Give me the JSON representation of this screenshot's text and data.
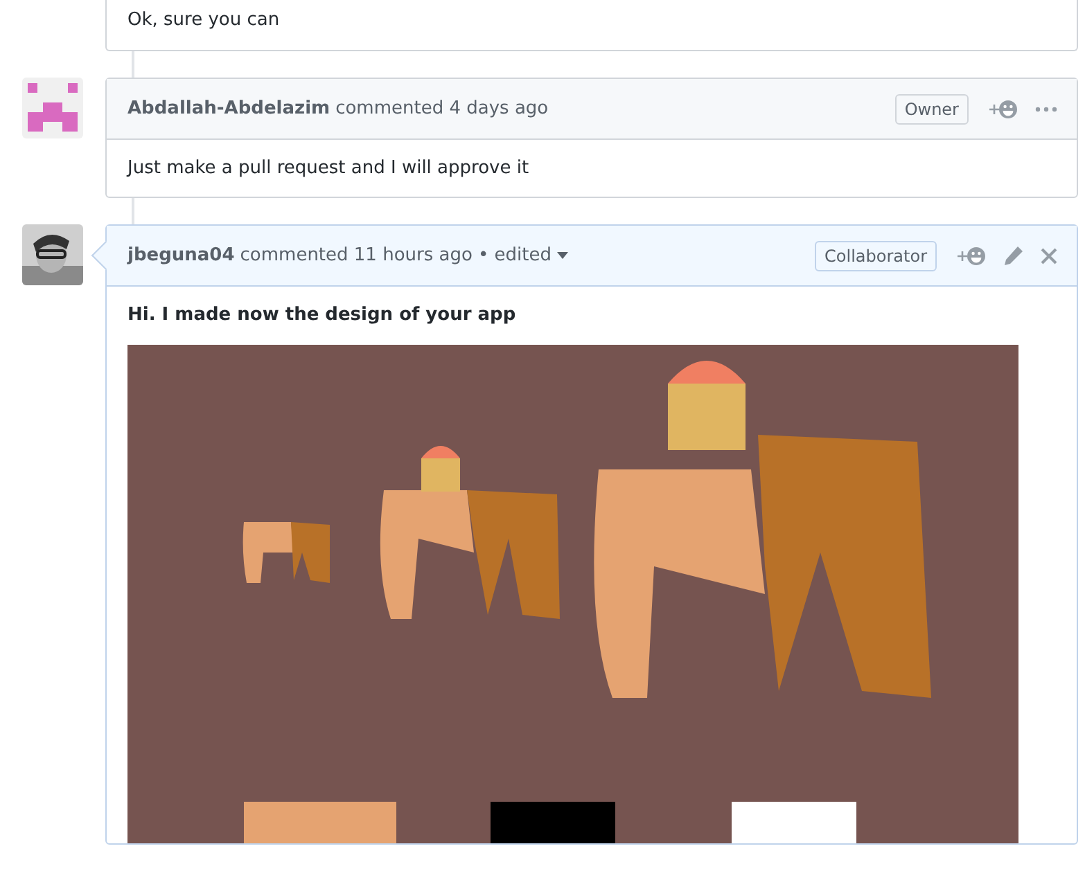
{
  "comments": [
    {
      "body": "Ok, sure you can"
    },
    {
      "avatar": {
        "kind": "pixel"
      },
      "author": "Abdallah-Abdelazim",
      "action": "commented 4 days ago",
      "role": "Owner",
      "highlighted": false,
      "actions": [
        {
          "kind": "reaction"
        },
        {
          "kind": "more"
        }
      ],
      "body": "Just make a pull request and I will approve it"
    },
    {
      "author": "jbeguna04",
      "action": "commented 11 hours ago",
      "edit_note": "• edited",
      "role": "Collaborator",
      "highlighted": true,
      "actions": [
        {
          "kind": "reaction"
        },
        {
          "kind": "edit"
        },
        {
          "kind": "close"
        }
      ],
      "body": "Hi. I made now the design of your app"
    }
  ]
}
